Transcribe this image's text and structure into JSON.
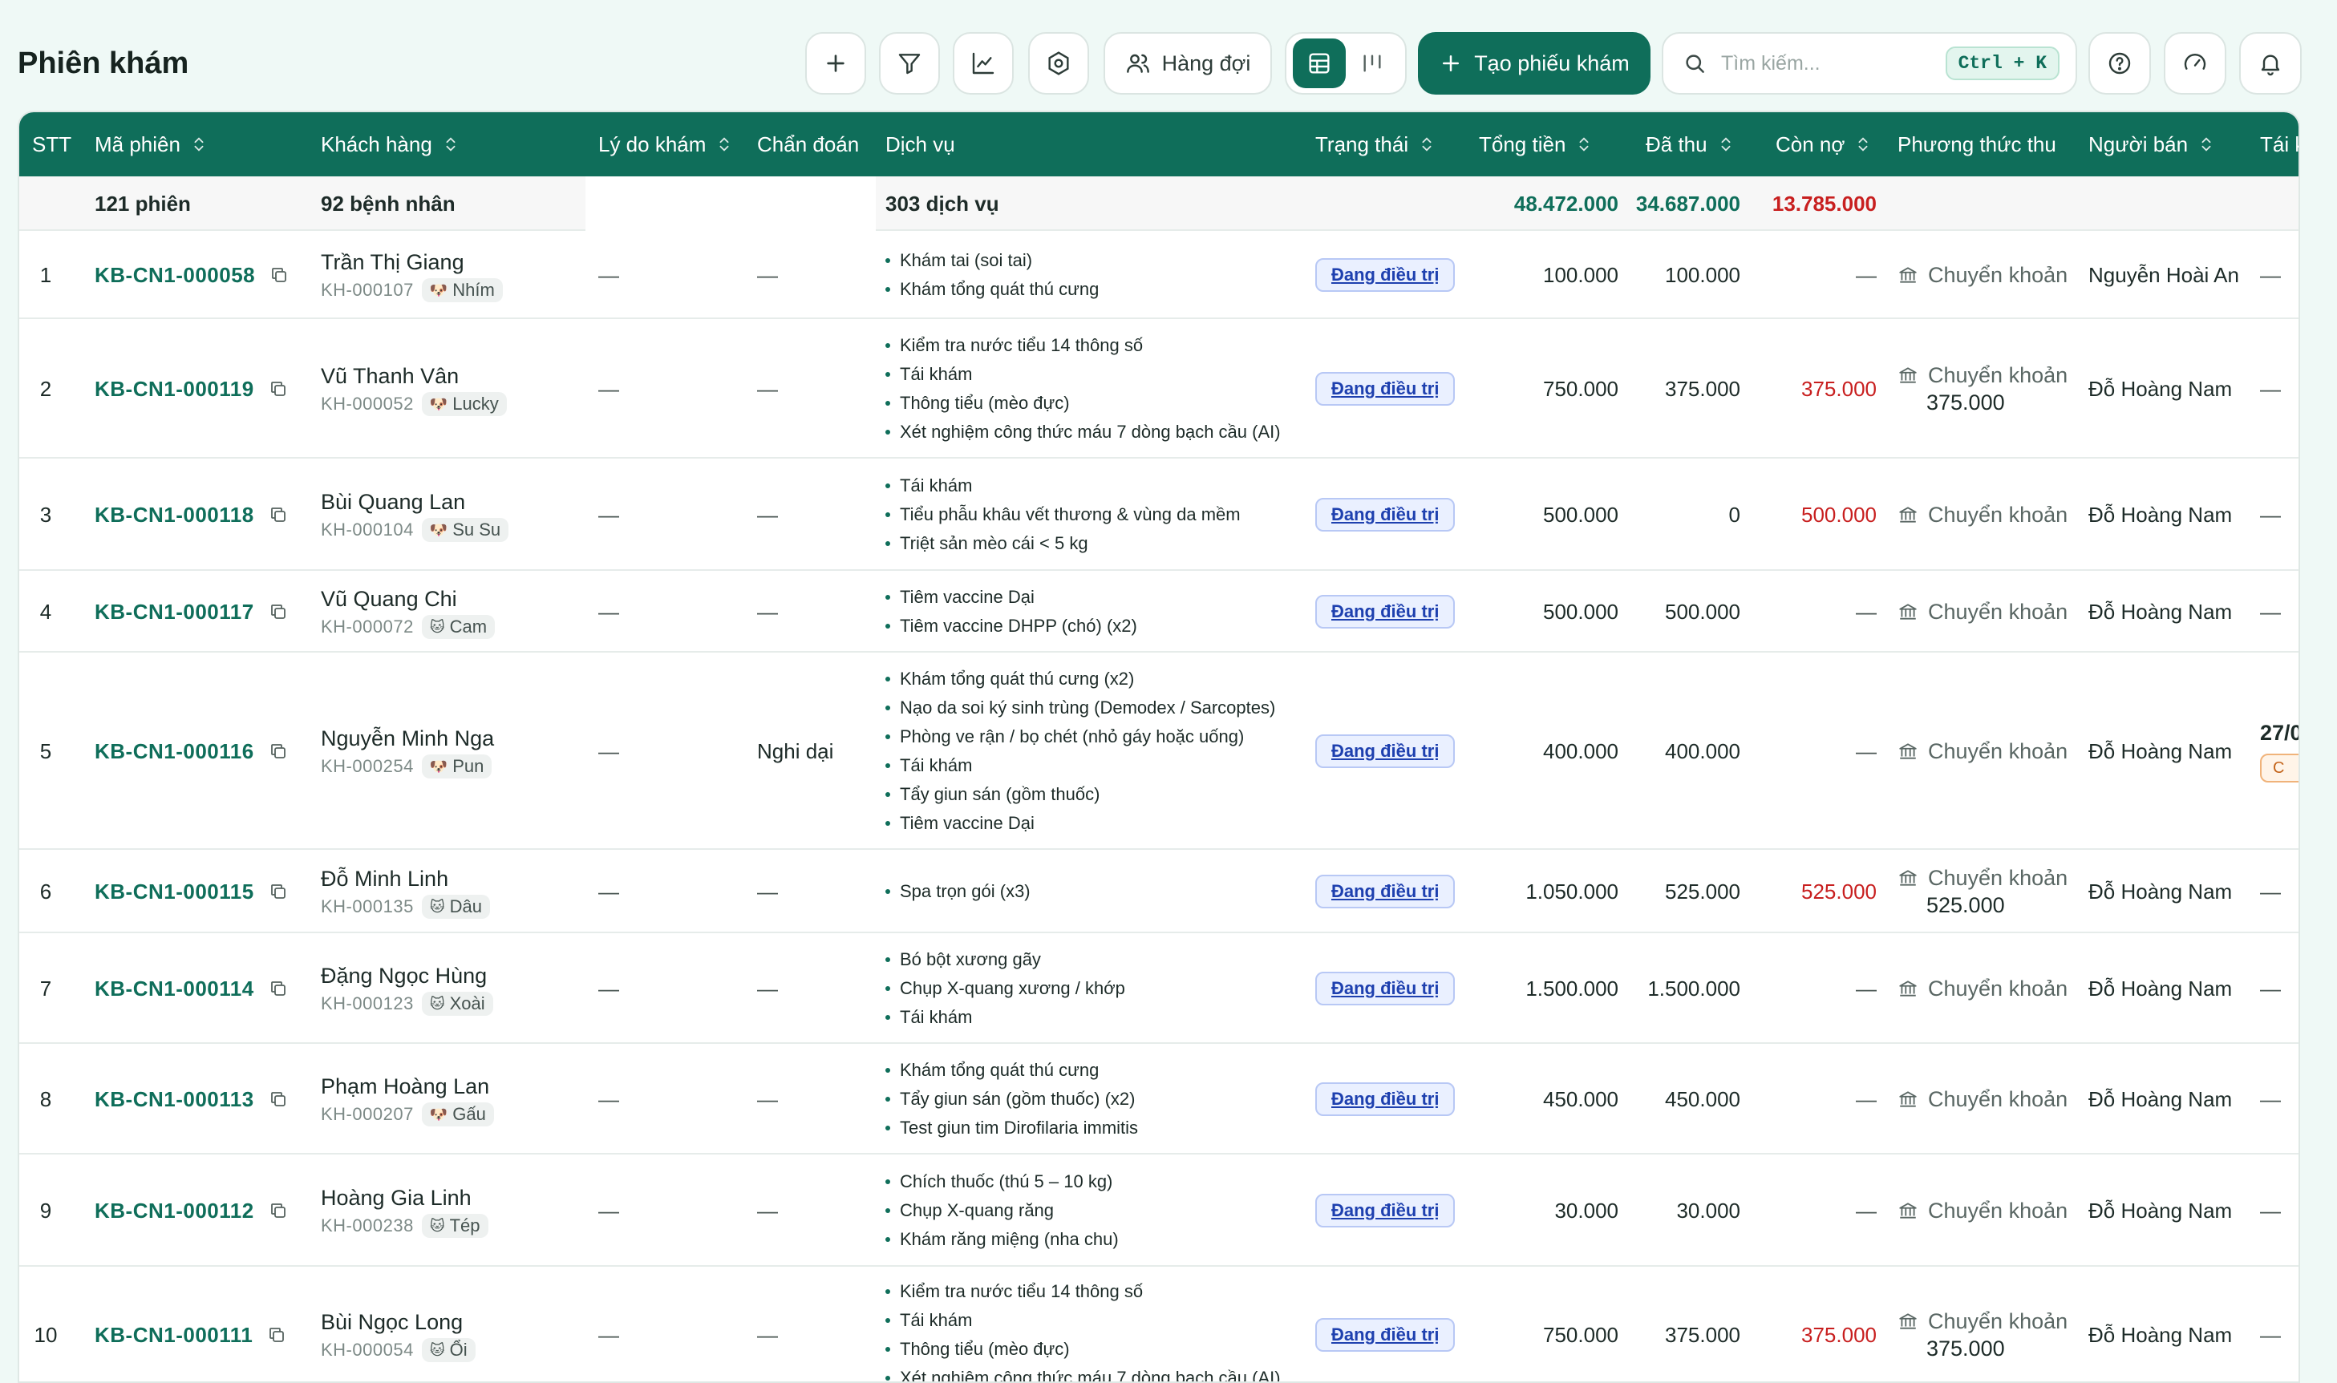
{
  "header": {
    "title": "Phiên khám",
    "queue_label": "Hàng đợi",
    "create_label": "Tạo phiếu khám",
    "search_placeholder": "Tìm kiếm...",
    "search_shortcut": "Ctrl + K"
  },
  "table": {
    "columns": [
      "STT",
      "Mã phiên",
      "Khách hàng",
      "Lý do khám",
      "Chẩn đoán",
      "Dịch vụ",
      "Trạng thái",
      "Tổng tiền",
      "Đã thu",
      "Còn nợ",
      "Phương thức thu",
      "Người bán",
      "Tái k"
    ],
    "summary": {
      "sessions": "121 phiên",
      "patients": "92 bệnh nhân",
      "services": "303 dịch vụ",
      "total": "48.472.000",
      "paid": "34.687.000",
      "debt": "13.785.000"
    },
    "rows": [
      {
        "stt": "1",
        "code": "KB-CN1-000058",
        "name": "Trần Thị Giang",
        "cid": "KH-000107",
        "pet": "Nhím",
        "pet_icon": "🐶",
        "reason": "—",
        "diagnosis": "—",
        "services": [
          "Khám tai (soi tai)",
          "Khám tổng quát thú cưng"
        ],
        "status": "Đang điều trị",
        "total": "100.000",
        "paid": "100.000",
        "debt": "—",
        "method": "Chuyển khoản",
        "method_amount": "",
        "seller": "Nguyễn Hoài An",
        "followup": "—"
      },
      {
        "stt": "2",
        "code": "KB-CN1-000119",
        "name": "Vũ Thanh Vân",
        "cid": "KH-000052",
        "pet": "Lucky",
        "pet_icon": "🐶",
        "reason": "—",
        "diagnosis": "—",
        "services": [
          "Kiểm tra nước tiểu 14 thông số",
          "Tái khám",
          "Thông tiểu (mèo đực)",
          "Xét nghiệm công thức máu 7 dòng bạch cầu (AI)"
        ],
        "status": "Đang điều trị",
        "total": "750.000",
        "paid": "375.000",
        "debt": "375.000",
        "method": "Chuyển khoản",
        "method_amount": "375.000",
        "seller": "Đỗ Hoàng Nam",
        "followup": "—"
      },
      {
        "stt": "3",
        "code": "KB-CN1-000118",
        "name": "Bùi Quang Lan",
        "cid": "KH-000104",
        "pet": "Su Su",
        "pet_icon": "🐶",
        "reason": "—",
        "diagnosis": "—",
        "services": [
          "Tái khám",
          "Tiểu phẫu khâu vết thương & vùng da mềm",
          "Triệt sản mèo cái < 5 kg"
        ],
        "status": "Đang điều trị",
        "total": "500.000",
        "paid": "0",
        "debt": "500.000",
        "method": "Chuyển khoản",
        "method_amount": "",
        "seller": "Đỗ Hoàng Nam",
        "followup": "—"
      },
      {
        "stt": "4",
        "code": "KB-CN1-000117",
        "name": "Vũ Quang Chi",
        "cid": "KH-000072",
        "pet": "Cam",
        "pet_icon": "🐱",
        "reason": "—",
        "diagnosis": "—",
        "services": [
          "Tiêm vaccine Dại",
          "Tiêm vaccine DHPP (chó) (x2)"
        ],
        "status": "Đang điều trị",
        "total": "500.000",
        "paid": "500.000",
        "debt": "—",
        "method": "Chuyển khoản",
        "method_amount": "",
        "seller": "Đỗ Hoàng Nam",
        "followup": "—"
      },
      {
        "stt": "5",
        "code": "KB-CN1-000116",
        "name": "Nguyễn Minh Nga",
        "cid": "KH-000254",
        "pet": "Pun",
        "pet_icon": "🐶",
        "reason": "—",
        "diagnosis": "Nghi dại",
        "services": [
          "Khám tổng quát thú cưng (x2)",
          "Nạo da soi ký sinh trùng (Demodex / Sarcoptes)",
          "Phòng ve rận / bọ chét (nhỏ gáy hoặc uống)",
          "Tái khám",
          "Tẩy giun sán (gồm thuốc)",
          "Tiêm vaccine Dại"
        ],
        "status": "Đang điều trị",
        "total": "400.000",
        "paid": "400.000",
        "debt": "—",
        "method": "Chuyển khoản",
        "method_amount": "",
        "seller": "Đỗ Hoàng Nam",
        "followup": "27/0",
        "followup_chip": "C"
      },
      {
        "stt": "6",
        "code": "KB-CN1-000115",
        "name": "Đỗ Minh Linh",
        "cid": "KH-000135",
        "pet": "Dâu",
        "pet_icon": "🐱",
        "reason": "—",
        "diagnosis": "—",
        "services": [
          "Spa trọn gói (x3)"
        ],
        "status": "Đang điều trị",
        "total": "1.050.000",
        "paid": "525.000",
        "debt": "525.000",
        "method": "Chuyển khoản",
        "method_amount": "525.000",
        "seller": "Đỗ Hoàng Nam",
        "followup": "—"
      },
      {
        "stt": "7",
        "code": "KB-CN1-000114",
        "name": "Đặng Ngọc Hùng",
        "cid": "KH-000123",
        "pet": "Xoài",
        "pet_icon": "🐱",
        "reason": "—",
        "diagnosis": "—",
        "services": [
          "Bó bột xương gãy",
          "Chụp X-quang xương / khớp",
          "Tái khám"
        ],
        "status": "Đang điều trị",
        "total": "1.500.000",
        "paid": "1.500.000",
        "debt": "—",
        "method": "Chuyển khoản",
        "method_amount": "",
        "seller": "Đỗ Hoàng Nam",
        "followup": "—"
      },
      {
        "stt": "8",
        "code": "KB-CN1-000113",
        "name": "Phạm Hoàng Lan",
        "cid": "KH-000207",
        "pet": "Gấu",
        "pet_icon": "🐶",
        "reason": "—",
        "diagnosis": "—",
        "services": [
          "Khám tổng quát thú cưng",
          "Tẩy giun sán (gồm thuốc) (x2)",
          "Test giun tim Dirofilaria immitis"
        ],
        "status": "Đang điều trị",
        "total": "450.000",
        "paid": "450.000",
        "debt": "—",
        "method": "Chuyển khoản",
        "method_amount": "",
        "seller": "Đỗ Hoàng Nam",
        "followup": "—"
      },
      {
        "stt": "9",
        "code": "KB-CN1-000112",
        "name": "Hoàng Gia Linh",
        "cid": "KH-000238",
        "pet": "Tép",
        "pet_icon": "🐱",
        "reason": "—",
        "diagnosis": "—",
        "services": [
          "Chích thuốc (thú 5 – 10 kg)",
          "Chụp X-quang răng",
          "Khám răng miệng (nha chu)"
        ],
        "status": "Đang điều trị",
        "total": "30.000",
        "paid": "30.000",
        "debt": "—",
        "method": "Chuyển khoản",
        "method_amount": "",
        "seller": "Đỗ Hoàng Nam",
        "followup": "—"
      },
      {
        "stt": "10",
        "code": "KB-CN1-000111",
        "name": "Bùi Ngọc Long",
        "cid": "KH-000054",
        "pet": "Ổi",
        "pet_icon": "🐱",
        "reason": "—",
        "diagnosis": "—",
        "services": [
          "Kiểm tra nước tiểu 14 thông số",
          "Tái khám",
          "Thông tiểu (mèo đực)",
          "Xét nghiệm công thức máu 7 dòng bạch cầu (AI)"
        ],
        "status": "Đang điều trị",
        "total": "750.000",
        "paid": "375.000",
        "debt": "375.000",
        "method": "Chuyển khoản",
        "method_amount": "375.000",
        "seller": "Đỗ Hoàng Nam",
        "followup": "—"
      }
    ]
  },
  "colors": {
    "primary": "#0f6e5a",
    "debt_red": "#c81f1f",
    "status_blue": "#1e40af",
    "background": "#eff9f6"
  },
  "icons": [
    "plus-icon",
    "filter-icon",
    "chart-icon",
    "settings-icon",
    "users-icon",
    "table-view-icon",
    "kanban-view-icon",
    "search-icon",
    "help-icon",
    "speedometer-icon",
    "bell-icon",
    "copy-icon",
    "bank-icon",
    "sort-icon"
  ]
}
